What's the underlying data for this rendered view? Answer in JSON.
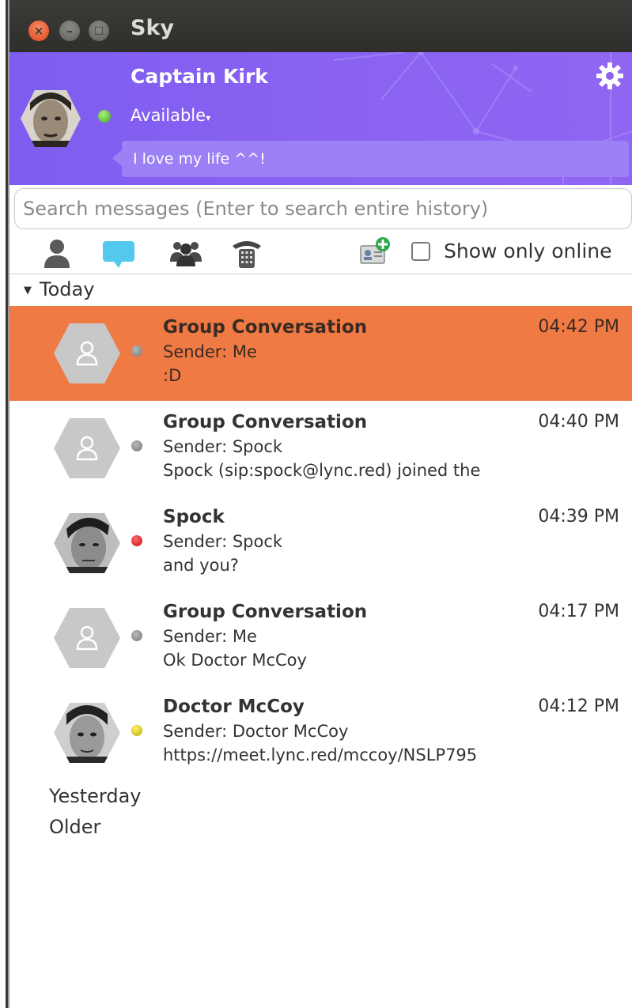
{
  "window": {
    "title": "Sky",
    "close_glyph": "×",
    "minimize_glyph": "–",
    "maximize_glyph": "□"
  },
  "profile": {
    "name": "Captain Kirk",
    "availability": "Available",
    "availability_caret": "▾",
    "mood": "I love my life ^^!",
    "status_color": "#3fa81e"
  },
  "search": {
    "placeholder": "Search messages (Enter to search entire history)"
  },
  "tabs": {
    "icons": [
      "contacts-icon",
      "chat-history-icon",
      "groups-icon",
      "phone-icon"
    ],
    "show_only_online": "Show only online"
  },
  "history": {
    "today_label": "Today",
    "today_arrow": "▼",
    "items": [
      {
        "name": "Group Conversation",
        "time": "04:42 PM",
        "sender": "Sender: Me",
        "message": ":D",
        "status": "offline"
      },
      {
        "name": "Group Conversation",
        "time": "04:40 PM",
        "sender": "Sender: Spock",
        "message": "Spock (sip:spock@lync.red) joined the",
        "status": "offline"
      },
      {
        "name": "Spock",
        "time": "04:39 PM",
        "sender": "Sender: Spock",
        "message": "and you?",
        "status": "busy"
      },
      {
        "name": "Group Conversation",
        "time": "04:17 PM",
        "sender": "Sender: Me",
        "message": "Ok Doctor McCoy",
        "status": "offline"
      },
      {
        "name": "Doctor McCoy",
        "time": "04:12 PM",
        "sender": "Sender: Doctor McCoy",
        "message": "https://meet.lync.red/mccoy/NSLP795",
        "status": "away"
      }
    ],
    "yesterday_label": "Yesterday",
    "older_label": "Older"
  },
  "colors": {
    "header_purple": "#8b63f2",
    "selected_row": "#f07a44",
    "chat_tab_accent": "#55c8f0"
  }
}
